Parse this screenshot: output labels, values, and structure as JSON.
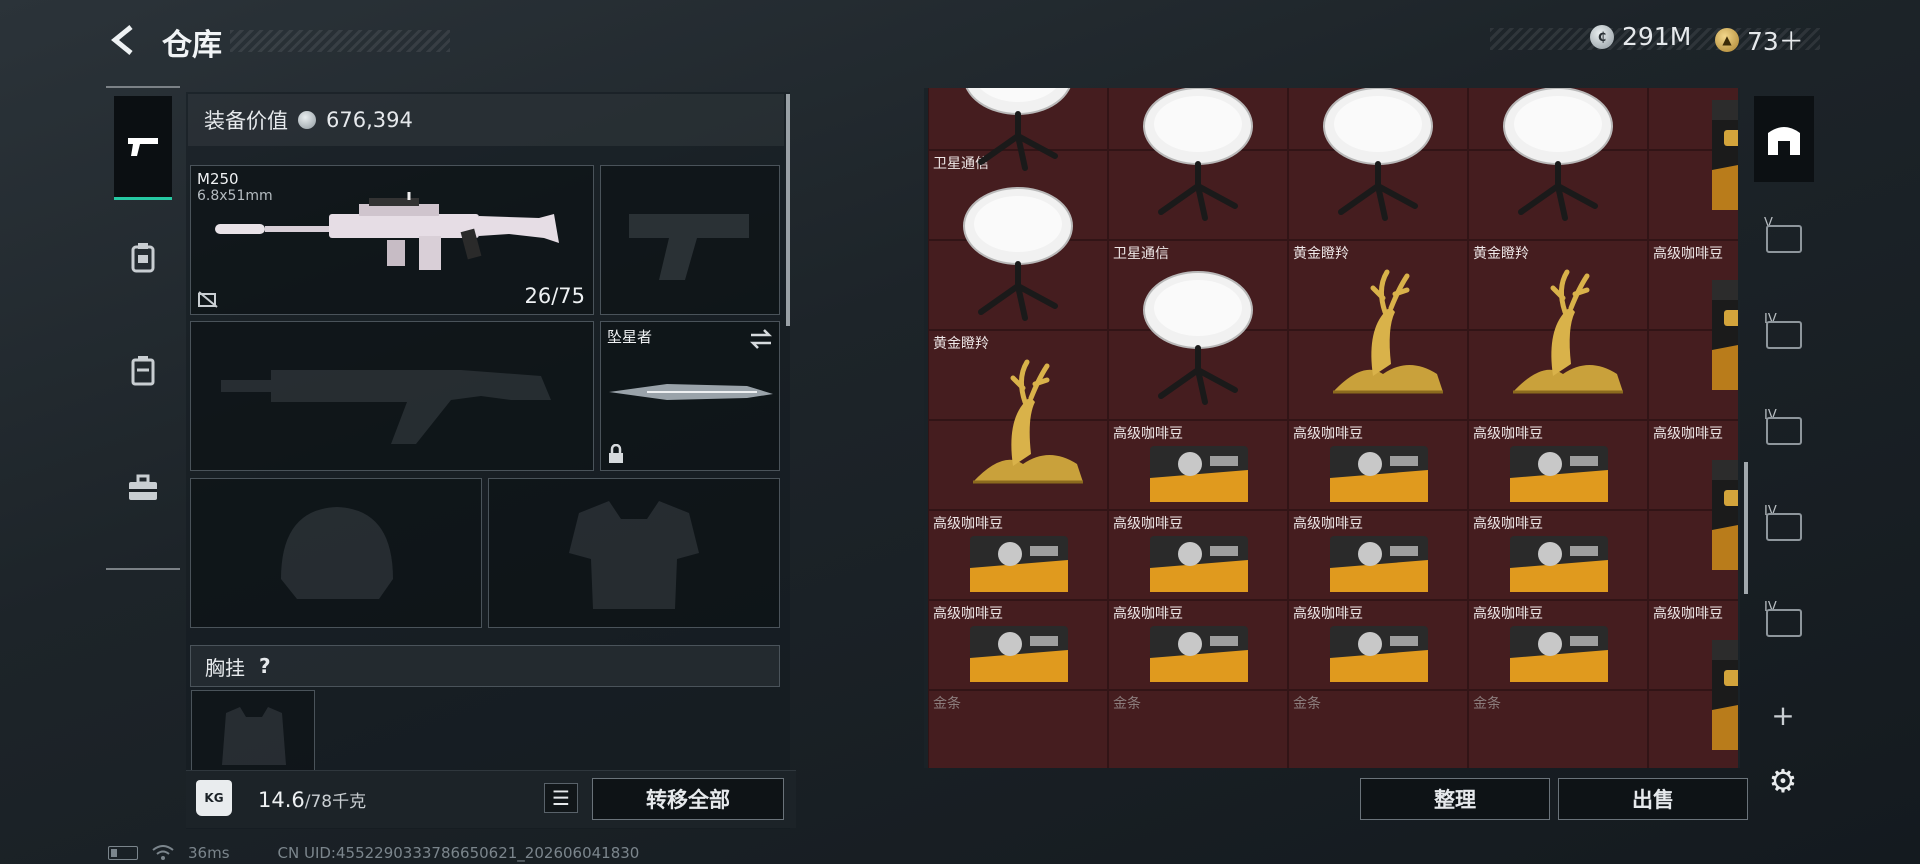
{
  "header": {
    "title": "仓库",
    "currency1": "291M",
    "currency2": "73＋"
  },
  "equipment": {
    "value_label": "装备价值",
    "value": "676,394",
    "primary": {
      "name": "M250",
      "caliber": "6.8x51mm",
      "ammo": "26/75"
    },
    "melee": {
      "name": "坠星者"
    },
    "chest_label": "胸挂",
    "chest_help": "?",
    "weight_value": "14.6",
    "weight_cap": "/78千克",
    "kg_icon_text": "KG",
    "transfer_all": "转移全部"
  },
  "inventory": {
    "rows": [
      [
        "",
        "卫星通信",
        "卫星通信",
        "卫星通信",
        "高级咖啡豆"
      ],
      [
        "卫星通信",
        "",
        "",
        "",
        ""
      ],
      [
        "",
        "卫星通信",
        "黄金瞪羚",
        "黄金瞪羚",
        "高级咖啡豆"
      ],
      [
        "黄金瞪羚",
        "",
        "",
        "",
        ""
      ],
      [
        "",
        "高级咖啡豆",
        "高级咖啡豆",
        "高级咖啡豆",
        "高级咖啡豆"
      ],
      [
        "高级咖啡豆",
        "高级咖啡豆",
        "高级咖啡豆",
        "高级咖啡豆",
        ""
      ],
      [
        "高级咖啡豆",
        "高级咖啡豆",
        "高级咖啡豆",
        "高级咖啡豆",
        "高级咖啡豆"
      ],
      [
        "金条",
        "金条",
        "金条",
        "金条",
        ""
      ]
    ],
    "sort_button": "整理",
    "sell_button": "出售"
  },
  "right_nav": {
    "tiers": [
      "V",
      "IV",
      "IV",
      "IV",
      "IV"
    ]
  },
  "status_bar": {
    "ping": "36ms",
    "uid": "CN UID:4552290333786650621_202606041830"
  }
}
